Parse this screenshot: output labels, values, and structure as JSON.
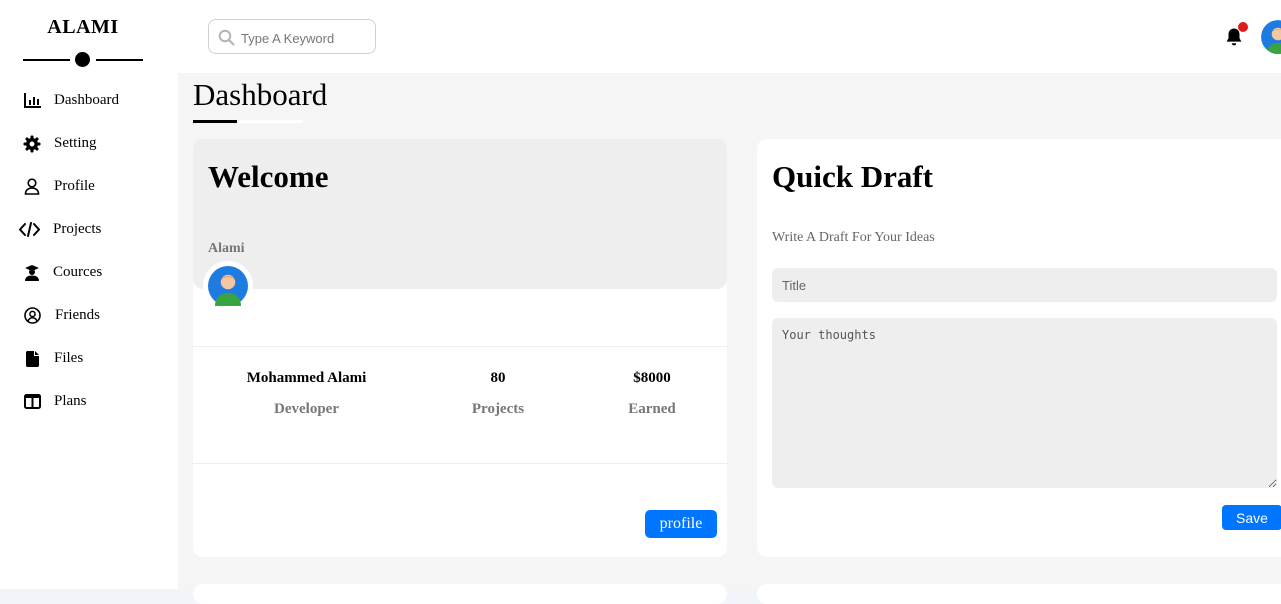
{
  "sidebar": {
    "brand": "ALAMI",
    "items": [
      {
        "label": "Dashboard",
        "icon": "chart-bar-icon"
      },
      {
        "label": "Setting",
        "icon": "gear-icon"
      },
      {
        "label": "Profile",
        "icon": "user-icon"
      },
      {
        "label": "Projects",
        "icon": "code-icon"
      },
      {
        "label": "Cources",
        "icon": "graduation-icon"
      },
      {
        "label": "Friends",
        "icon": "user-circle-icon"
      },
      {
        "label": "Files",
        "icon": "file-icon"
      },
      {
        "label": "Plans",
        "icon": "columns-icon"
      }
    ]
  },
  "header": {
    "search_placeholder": "Type A Keyword",
    "notification_dot_color": "#e01a1a"
  },
  "main": {
    "title": "Dashboard",
    "welcome": {
      "title": "Welcome",
      "name": "Alami",
      "stats": [
        {
          "value": "Mohammed Alami",
          "label": "Developer"
        },
        {
          "value": "80",
          "label": "Projects"
        },
        {
          "value": "$8000",
          "label": "Earned"
        }
      ],
      "button": "profile"
    },
    "draft": {
      "title": "Quick Draft",
      "subtitle": "Write A Draft For Your Ideas",
      "title_placeholder": "Title",
      "text_placeholder": "Your thoughts",
      "button": "Save"
    }
  },
  "colors": {
    "accent": "#0075ff",
    "card_head": "#eeeeee",
    "content_bg": "#f5f5f5"
  }
}
